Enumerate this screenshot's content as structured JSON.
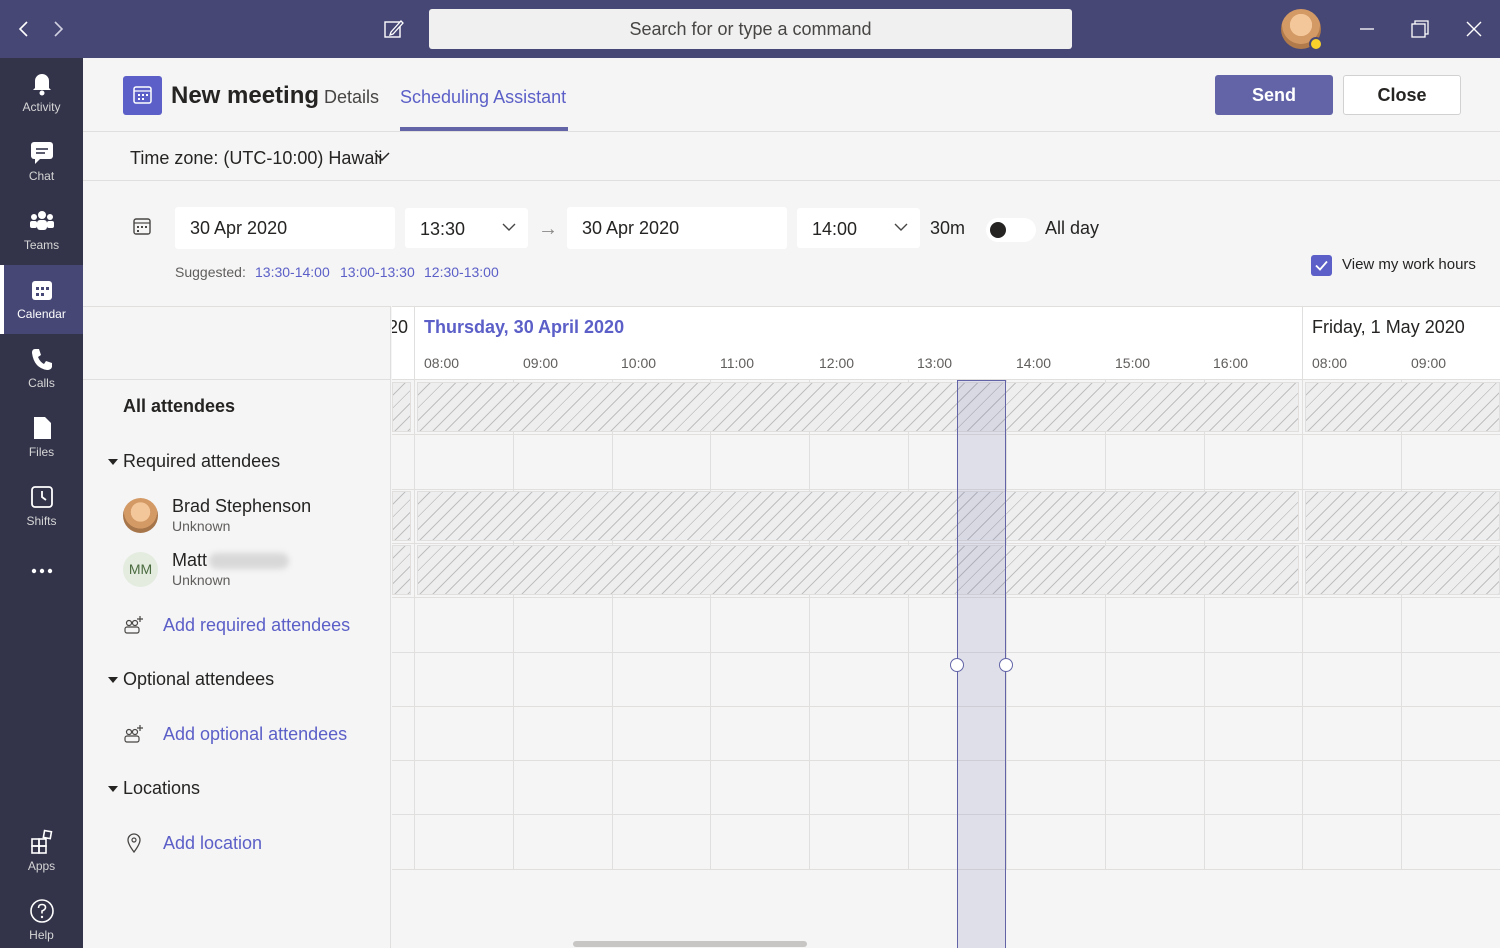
{
  "titlebar": {
    "search_placeholder": "Search for or type a command"
  },
  "rail": {
    "items": [
      {
        "label": "Activity",
        "icon": "bell-icon"
      },
      {
        "label": "Chat",
        "icon": "chat-icon"
      },
      {
        "label": "Teams",
        "icon": "teams-icon"
      },
      {
        "label": "Calendar",
        "icon": "calendar-icon",
        "active": true
      },
      {
        "label": "Calls",
        "icon": "phone-icon"
      },
      {
        "label": "Files",
        "icon": "file-icon"
      },
      {
        "label": "Shifts",
        "icon": "clock-icon"
      },
      {
        "label": "Apps",
        "icon": "apps-icon"
      },
      {
        "label": "Help",
        "icon": "help-icon"
      }
    ]
  },
  "header": {
    "title": "New meeting",
    "tabs": [
      {
        "label": "Details",
        "active": false
      },
      {
        "label": "Scheduling Assistant",
        "active": true
      }
    ],
    "send_label": "Send",
    "close_label": "Close"
  },
  "timezone": {
    "label": "Time zone:  (UTC-10:00) Hawaii"
  },
  "schedule": {
    "start_date": "30 Apr 2020",
    "start_time": "13:30",
    "end_date": "30 Apr 2020",
    "end_time": "14:00",
    "duration": "30m",
    "allday_label": "All day",
    "allday_on": false,
    "suggested_label": "Suggested:",
    "suggestions": [
      "13:30-14:00",
      "13:00-13:30",
      "12:30-13:00"
    ],
    "workhours_label": "View my work hours",
    "workhours_checked": true
  },
  "attendees": {
    "all_label": "All attendees",
    "required_title": "Required attendees",
    "people": [
      {
        "name": "Brad Stephenson",
        "status": "Unknown",
        "initials": ""
      },
      {
        "name": "Matt",
        "status": "Unknown",
        "initials": "MM"
      }
    ],
    "add_required": "Add required attendees",
    "optional_title": "Optional attendees",
    "add_optional": "Add optional attendees",
    "locations_title": "Locations",
    "add_location": "Add location"
  },
  "grid": {
    "prev_day_fragment": ")20",
    "day1": "Thursday, 30 April 2020",
    "day1_hours": [
      "08:00",
      "09:00",
      "10:00",
      "11:00",
      "12:00",
      "13:00",
      "14:00",
      "15:00",
      "16:00"
    ],
    "day2": "Friday, 1 May 2020",
    "day2_hours": [
      "08:00",
      "09:00"
    ]
  },
  "colors": {
    "brand": "#6264a7",
    "titlebar": "#464775",
    "rail": "#33344a"
  }
}
